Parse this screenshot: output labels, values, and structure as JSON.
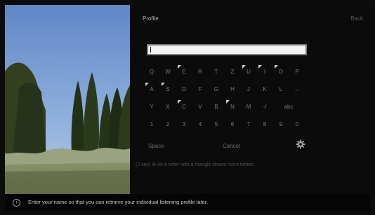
{
  "header": {
    "title": "Profile",
    "back_label": "Back"
  },
  "input": {
    "value": ""
  },
  "keyboard": {
    "rows": [
      [
        {
          "label": "Q",
          "more": false
        },
        {
          "label": "W",
          "more": false
        },
        {
          "label": "E",
          "more": true
        },
        {
          "label": "R",
          "more": false
        },
        {
          "label": "T",
          "more": false
        },
        {
          "label": "Z",
          "more": false
        },
        {
          "label": "U",
          "more": true
        },
        {
          "label": "I",
          "more": true
        },
        {
          "label": "O",
          "more": true
        },
        {
          "label": "P",
          "more": false
        }
      ],
      [
        {
          "label": "A",
          "more": true
        },
        {
          "label": "S",
          "more": true
        },
        {
          "label": "D",
          "more": false
        },
        {
          "label": "F",
          "more": false
        },
        {
          "label": "G",
          "more": false
        },
        {
          "label": "H",
          "more": false
        },
        {
          "label": "J",
          "more": false
        },
        {
          "label": "K",
          "more": false
        },
        {
          "label": "L",
          "more": false
        },
        {
          "label": "←",
          "more": false
        }
      ],
      [
        {
          "label": "Y",
          "more": false
        },
        {
          "label": "X",
          "more": false
        },
        {
          "label": "C",
          "more": true
        },
        {
          "label": "V",
          "more": false
        },
        {
          "label": "B",
          "more": false
        },
        {
          "label": "N",
          "more": true
        },
        {
          "label": "M",
          "more": false
        },
        {
          "label": "-/",
          "more": false
        },
        {
          "label": "abc",
          "more": false,
          "wide": true
        }
      ],
      [
        {
          "label": "1",
          "more": false
        },
        {
          "label": "2",
          "more": false
        },
        {
          "label": "3",
          "more": false
        },
        {
          "label": "4",
          "more": false
        },
        {
          "label": "5",
          "more": false
        },
        {
          "label": "6",
          "more": false
        },
        {
          "label": "7",
          "more": false
        },
        {
          "label": "8",
          "more": false
        },
        {
          "label": "9",
          "more": false
        },
        {
          "label": "0",
          "more": false
        }
      ]
    ],
    "space_label": "Space",
    "cancel_label": "Cancel",
    "settings_icon": "gear-icon"
  },
  "hint": "(2 sec) ⊕ on a letter with a triangle shows more letters",
  "footer": {
    "icon": "info-icon",
    "icon_glyph": "i",
    "text": "Enter your name so that you can retrieve your individual listening profile later."
  }
}
